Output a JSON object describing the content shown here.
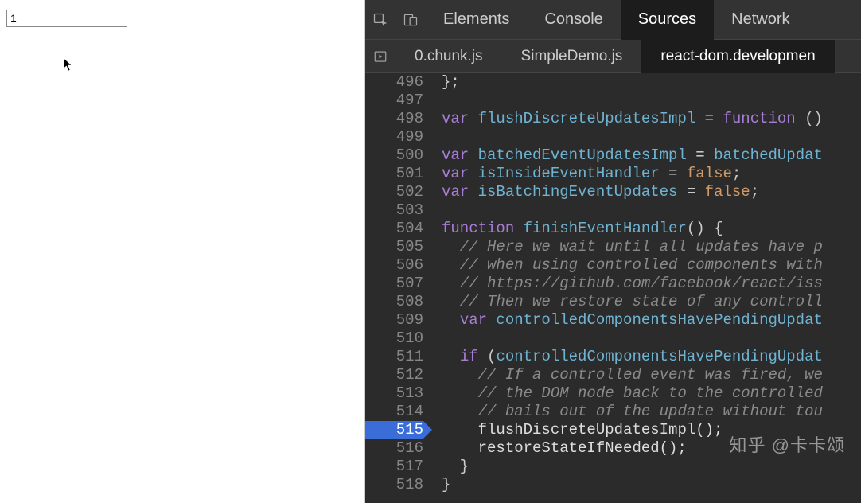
{
  "page": {
    "input_value": "1"
  },
  "devtools": {
    "main_tabs": [
      {
        "label": "Elements",
        "active": false
      },
      {
        "label": "Console",
        "active": false
      },
      {
        "label": "Sources",
        "active": true
      },
      {
        "label": "Network",
        "active": false
      }
    ],
    "file_tabs": [
      {
        "label": "0.chunk.js",
        "active": false
      },
      {
        "label": "SimpleDemo.js",
        "active": false
      },
      {
        "label": "react-dom.developmen",
        "active": true
      }
    ],
    "breakpoint_line": 515,
    "code_lines": [
      {
        "n": 496,
        "tokens": [
          [
            "};",
            "punc"
          ]
        ]
      },
      {
        "n": 497,
        "tokens": [
          [
            "",
            ""
          ]
        ]
      },
      {
        "n": 498,
        "tokens": [
          [
            "var ",
            "kw"
          ],
          [
            "flushDiscreteUpdatesImpl",
            "fn"
          ],
          [
            " = ",
            "op"
          ],
          [
            "function",
            "kw2"
          ],
          [
            " ()",
            "punc"
          ]
        ]
      },
      {
        "n": 499,
        "tokens": [
          [
            "",
            ""
          ]
        ]
      },
      {
        "n": 500,
        "tokens": [
          [
            "var ",
            "kw"
          ],
          [
            "batchedEventUpdatesImpl",
            "fn"
          ],
          [
            " = ",
            "op"
          ],
          [
            "batchedUpdat",
            "fn"
          ]
        ]
      },
      {
        "n": 501,
        "tokens": [
          [
            "var ",
            "kw"
          ],
          [
            "isInsideEventHandler",
            "fn"
          ],
          [
            " = ",
            "op"
          ],
          [
            "false",
            "lit"
          ],
          [
            ";",
            "punc"
          ]
        ]
      },
      {
        "n": 502,
        "tokens": [
          [
            "var ",
            "kw"
          ],
          [
            "isBatchingEventUpdates",
            "fn"
          ],
          [
            " = ",
            "op"
          ],
          [
            "false",
            "lit"
          ],
          [
            ";",
            "punc"
          ]
        ]
      },
      {
        "n": 503,
        "tokens": [
          [
            "",
            ""
          ]
        ]
      },
      {
        "n": 504,
        "tokens": [
          [
            "function ",
            "kw2"
          ],
          [
            "finishEventHandler",
            "fnname"
          ],
          [
            "() {",
            "punc"
          ]
        ]
      },
      {
        "n": 505,
        "tokens": [
          [
            "  // Here we wait until all updates have p",
            "cmt"
          ]
        ]
      },
      {
        "n": 506,
        "tokens": [
          [
            "  // when using controlled components with",
            "cmt"
          ]
        ]
      },
      {
        "n": 507,
        "tokens": [
          [
            "  // https://github.com/facebook/react/iss",
            "cmt"
          ]
        ]
      },
      {
        "n": 508,
        "tokens": [
          [
            "  // Then we restore state of any controll",
            "cmt"
          ]
        ]
      },
      {
        "n": 509,
        "tokens": [
          [
            "  ",
            ""
          ],
          [
            "var ",
            "kw"
          ],
          [
            "controlledComponentsHavePendingUpdat",
            "fn"
          ]
        ]
      },
      {
        "n": 510,
        "tokens": [
          [
            "",
            ""
          ]
        ]
      },
      {
        "n": 511,
        "tokens": [
          [
            "  ",
            ""
          ],
          [
            "if ",
            "kw"
          ],
          [
            "(",
            "punc"
          ],
          [
            "controlledComponentsHavePendingUpdat",
            "fn"
          ]
        ]
      },
      {
        "n": 512,
        "tokens": [
          [
            "    // If a controlled event was fired, we",
            "cmt"
          ]
        ]
      },
      {
        "n": 513,
        "tokens": [
          [
            "    // the DOM node back to the controlled",
            "cmt"
          ]
        ]
      },
      {
        "n": 514,
        "tokens": [
          [
            "    // bails out of the update without tou",
            "cmt"
          ]
        ]
      },
      {
        "n": 515,
        "tokens": [
          [
            "    flushDiscreteUpdatesImpl();",
            "op"
          ]
        ]
      },
      {
        "n": 516,
        "tokens": [
          [
            "    restoreStateIfNeeded();",
            "op"
          ]
        ]
      },
      {
        "n": 517,
        "tokens": [
          [
            "  }",
            "punc"
          ]
        ]
      },
      {
        "n": 518,
        "tokens": [
          [
            "}",
            "punc"
          ]
        ]
      }
    ]
  },
  "watermark": "知乎 @卡卡颂"
}
